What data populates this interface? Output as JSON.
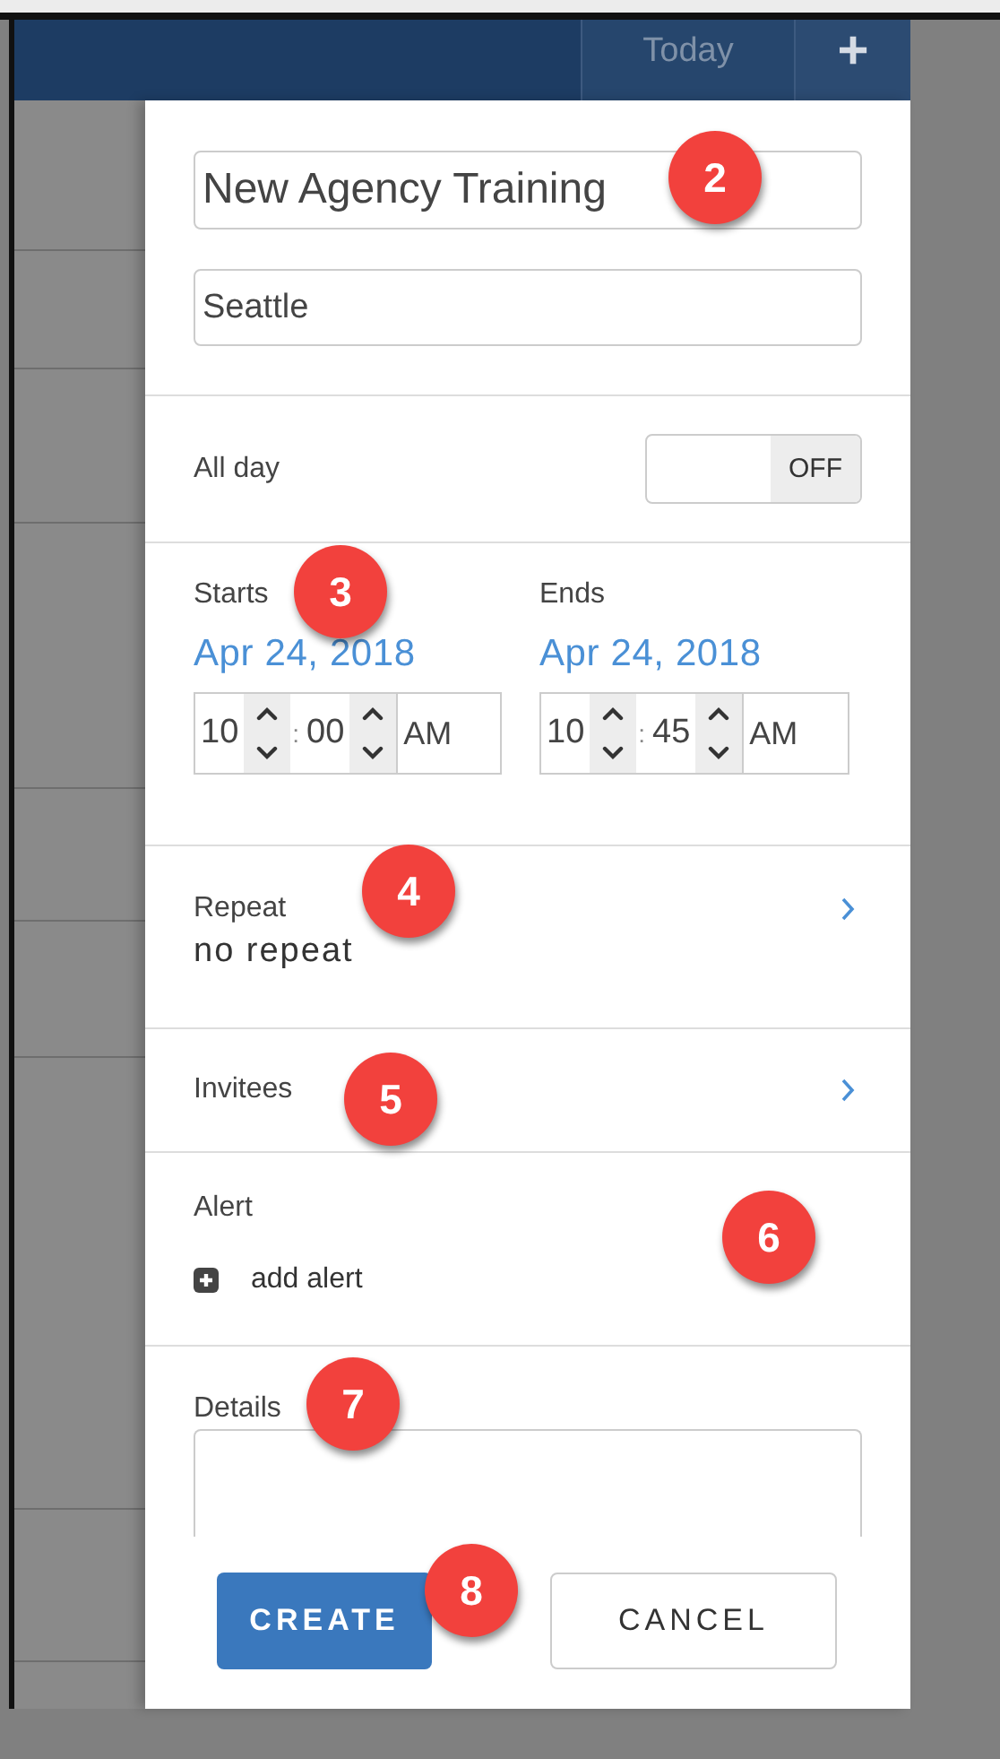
{
  "header": {
    "today_button": "Today",
    "add_button": "+"
  },
  "form": {
    "title": {
      "value": "New Agency Training",
      "badge": "2"
    },
    "location": {
      "value": "Seattle"
    },
    "all_day": {
      "label": "All day",
      "on": false,
      "state_label": "OFF"
    },
    "dates_badge": "3",
    "starts": {
      "label": "Starts",
      "date": "Apr 24, 2018",
      "hour": "10",
      "separator": ":",
      "minute": "00",
      "period": "AM"
    },
    "ends": {
      "label": "Ends",
      "date": "Apr 24, 2018",
      "hour": "10",
      "separator": ":",
      "minute": "45",
      "period": "AM"
    },
    "repeat": {
      "label": "Repeat",
      "value": "no repeat",
      "badge": "4"
    },
    "invitees": {
      "label": "Invitees",
      "badge": "5"
    },
    "alert": {
      "label": "Alert",
      "action": "add alert",
      "badge": "6"
    },
    "details": {
      "label": "Details",
      "badge": "7"
    },
    "buttons": [
      {
        "label": "CREATE",
        "kind": "primary"
      },
      {
        "label": "CANCEL",
        "kind": "secondary"
      }
    ],
    "buttons_badge": "8"
  }
}
